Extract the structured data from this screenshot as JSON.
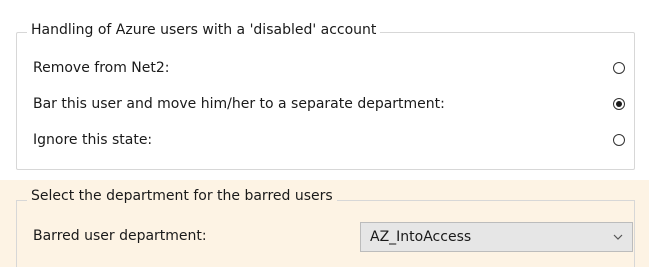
{
  "disabled_handling": {
    "group_title": "Handling of Azure users with a 'disabled' account",
    "options": [
      {
        "label": "Remove from Net2:",
        "checked": false
      },
      {
        "label": "Bar this user and move him/her to a separate department:",
        "checked": true
      },
      {
        "label": "Ignore this state:",
        "checked": false
      }
    ]
  },
  "department_selection": {
    "group_title": "Select the department for the barred users",
    "field_label": "Barred user department:",
    "selected_value": "AZ_IntoAccess",
    "chevron_icon": "chevron-down-icon"
  },
  "colors": {
    "panel_background": "#fdf3e4",
    "border": "#d7d7d7",
    "select_background": "#e6e6e6"
  }
}
